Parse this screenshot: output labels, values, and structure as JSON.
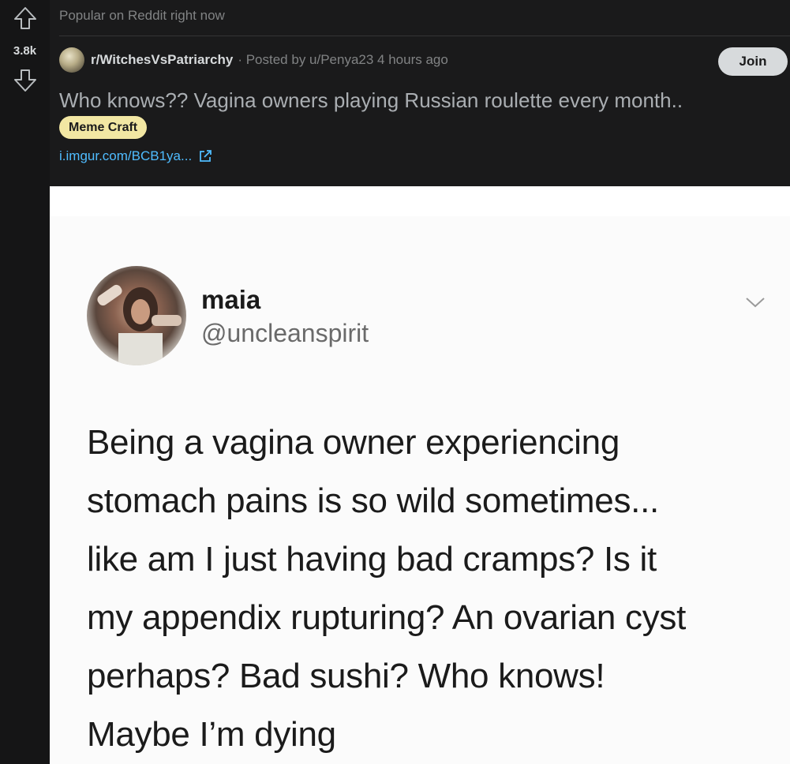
{
  "vote": {
    "count": "3.8k"
  },
  "header": {
    "popular": "Popular on Reddit right now",
    "subreddit": "r/WitchesVsPatriarchy",
    "meta": "· Posted by u/Penya23 4 hours ago",
    "join_label": "Join",
    "title": "Who knows?? Vagina owners playing Russian roulette every month..",
    "flair": "Meme Craft",
    "link": "i.imgur.com/BCB1ya..."
  },
  "tweet": {
    "name": "maia",
    "handle": "@uncleanspirit",
    "text": "Being a vagina owner experiencing\nstomach pains is so wild sometimes...\nlike am I just having bad cramps? Is it\nmy appendix rupturing? An ovarian cyst\nperhaps? Bad sushi? Who knows!\nMaybe I’m dying"
  },
  "colors": {
    "background": "#1a1a1b",
    "link": "#4fbcff",
    "flair": "#f2e7a3",
    "join_button": "#d7dadc"
  },
  "icons": {
    "upvote": "arrow-up-icon",
    "downvote": "arrow-down-icon",
    "external_link": "external-link-icon",
    "more": "chevron-down-icon"
  }
}
